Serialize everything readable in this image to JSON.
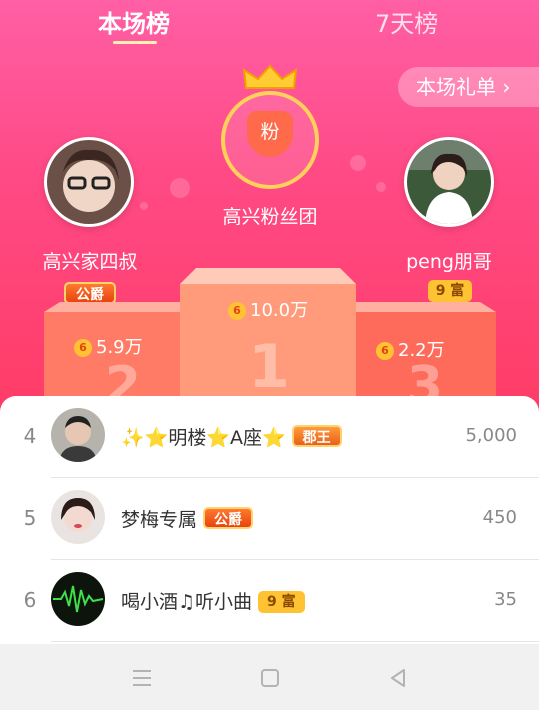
{
  "tabs": [
    {
      "label": "本场榜",
      "active": true
    },
    {
      "label": "7天榜",
      "active": false
    }
  ],
  "gift_list_button": "本场礼单 ›",
  "fan_club": {
    "gem_label": "粉",
    "title": "高兴粉丝团"
  },
  "podium": {
    "first": {
      "rank_numeral": "1",
      "score": "10.0万"
    },
    "second": {
      "rank_numeral": "2",
      "name": "高兴家四叔",
      "badge": "公爵",
      "score": "5.9万"
    },
    "third": {
      "rank_numeral": "3",
      "name": "peng朋哥",
      "badge": "9 富",
      "score": "2.2万"
    }
  },
  "coin_glyph": "6",
  "list": [
    {
      "rank": "4",
      "name": "✨⭐明楼⭐A座⭐",
      "badge": "郡王",
      "value": "5,000"
    },
    {
      "rank": "5",
      "name": "梦梅专属",
      "badge": "公爵",
      "value": "450"
    },
    {
      "rank": "6",
      "name": "喝小酒♫听小曲",
      "badge": "9 富",
      "value": "35"
    }
  ],
  "navbar": {
    "icons": [
      "menu-icon",
      "home-square-icon",
      "back-triangle-icon"
    ]
  },
  "colors": {
    "accent_pink": "#ff4a86",
    "gold": "#ffc233",
    "white": "#ffffff"
  }
}
